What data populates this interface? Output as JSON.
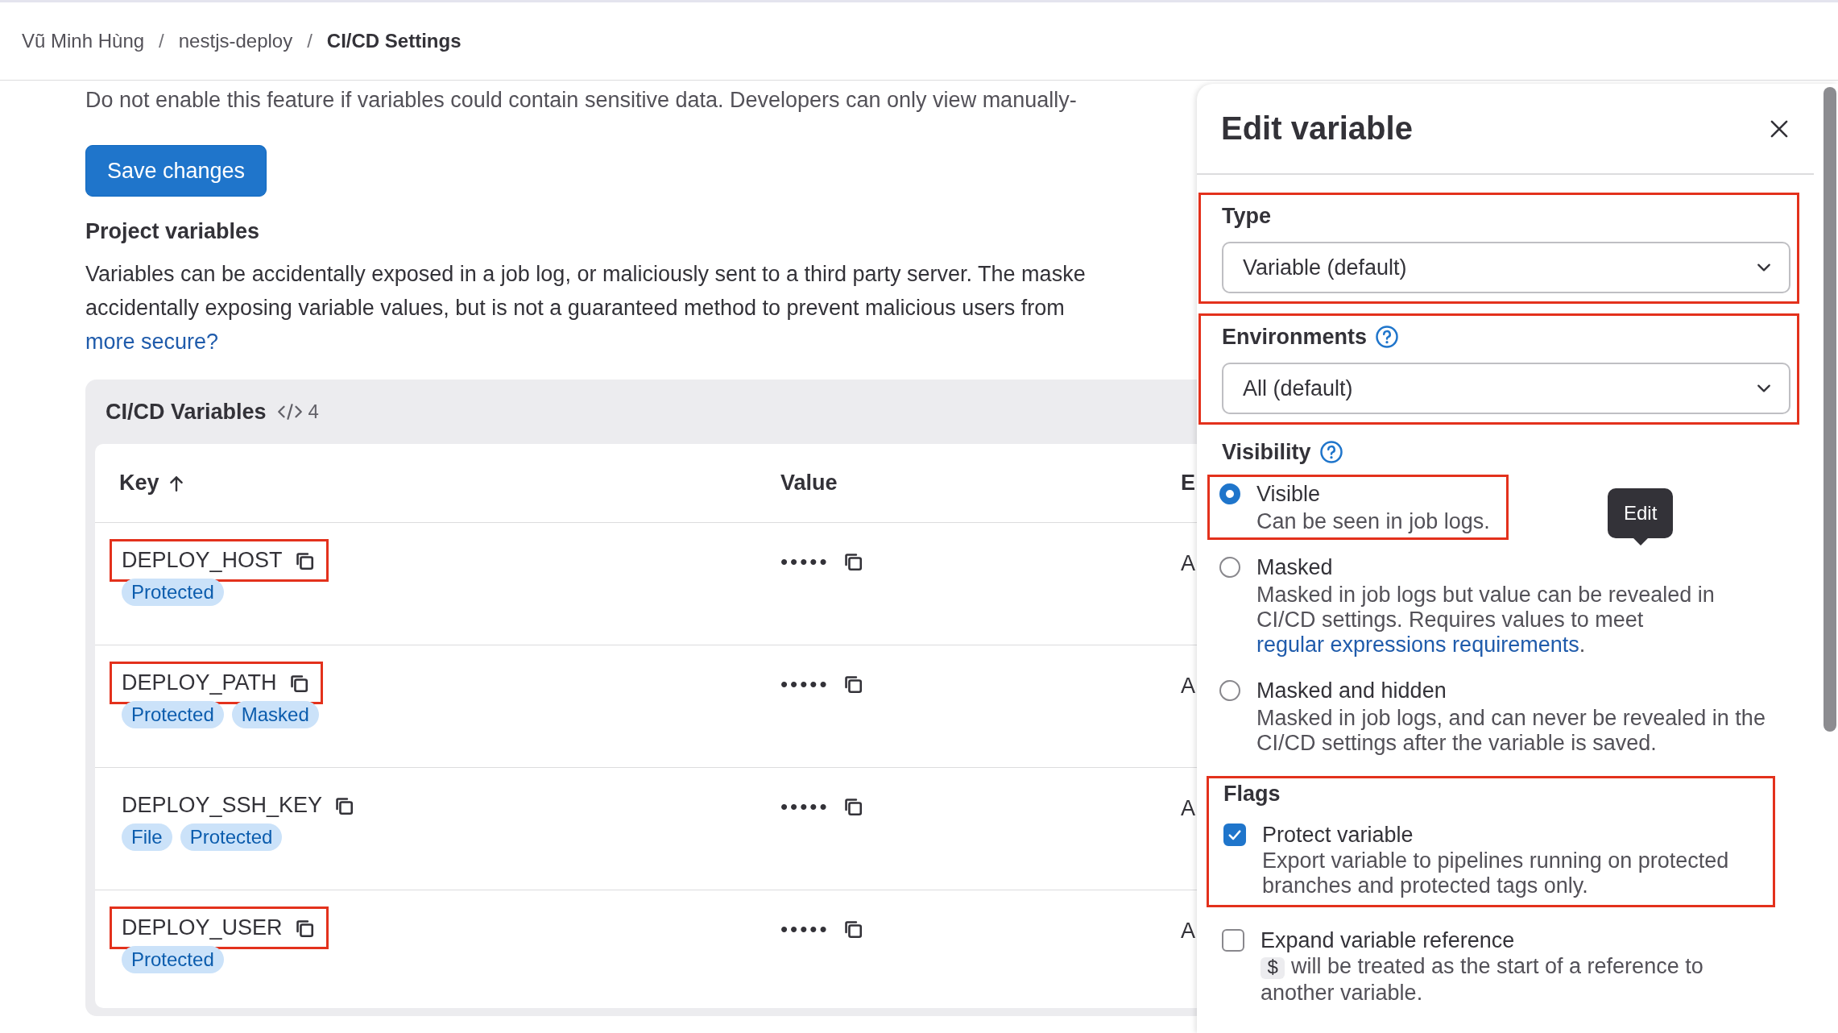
{
  "breadcrumb": [
    {
      "label": "Vũ Minh Hùng",
      "current": false,
      "separator": "/"
    },
    {
      "label": "nestjs-deploy",
      "current": false,
      "separator": "/"
    },
    {
      "label": "CI/CD Settings",
      "current": true
    }
  ],
  "notice": "Do not enable this feature if variables could contain sensitive data. Developers can only view manually-",
  "save_button": "Save changes",
  "project_variables": {
    "heading": "Project variables",
    "description_lines": [
      "Variables can be accidentally exposed in a job log, or maliciously sent to a third party server. The maske",
      "accidentally exposing variable values, but is not a guaranteed method to prevent malicious users from"
    ],
    "link": "more secure?"
  },
  "variables_card": {
    "title": "CI/CD Variables",
    "count": "4",
    "columns": [
      {
        "label": "Key",
        "sorted": true
      },
      {
        "label": "Value"
      },
      {
        "label": "E"
      }
    ],
    "rows": [
      {
        "key": "DEPLOY_HOST",
        "highlighted": true,
        "badges": [
          "Protected"
        ],
        "value": "•••••",
        "column_3": "A"
      },
      {
        "key": "DEPLOY_PATH",
        "highlighted": true,
        "badges": [
          "Protected",
          "Masked"
        ],
        "value": "•••••",
        "column_3": "A"
      },
      {
        "key": "DEPLOY_SSH_KEY",
        "highlighted": false,
        "badges": [
          "File",
          "Protected"
        ],
        "value": "•••••",
        "column_3": "A"
      },
      {
        "key": "DEPLOY_USER",
        "highlighted": true,
        "badges": [
          "Protected"
        ],
        "value": "•••••",
        "column_3": "A"
      }
    ]
  },
  "drawer": {
    "title": "Edit variable",
    "fields": [
      {
        "kind": "select",
        "label": "Type",
        "help": false,
        "value": "Variable (default)",
        "highlighted": true
      },
      {
        "kind": "select",
        "label": "Environments",
        "help": true,
        "value": "All (default)",
        "highlighted": true
      }
    ],
    "visibility": {
      "label": "Visibility",
      "help": true,
      "options": [
        {
          "label": "Visible",
          "description": "Can be seen in job logs.",
          "selected": true,
          "highlighted": true
        },
        {
          "label": "Masked",
          "description": "Masked in job logs but value can be revealed in CI/CD settings. Requires values to meet ",
          "link": "regular expressions requirements",
          "description_end": ".",
          "selected": false,
          "highlighted": false
        },
        {
          "label": "Masked and hidden",
          "description": "Masked in job logs, and can never be revealed in the CI/CD settings after the variable is saved.",
          "selected": false,
          "highlighted": false
        }
      ]
    },
    "flags": {
      "label": "Flags",
      "highlighted": true,
      "items": [
        {
          "label": "Protect variable",
          "description": "Export variable to pipelines running on protected branches and protected tags only.",
          "checked": true,
          "highlighted": true
        },
        {
          "label": "Expand variable reference",
          "code": "$",
          "description": "will be treated as the start of a reference to another variable.",
          "checked": false,
          "highlighted": false
        }
      ]
    },
    "tooltip": "Edit"
  }
}
